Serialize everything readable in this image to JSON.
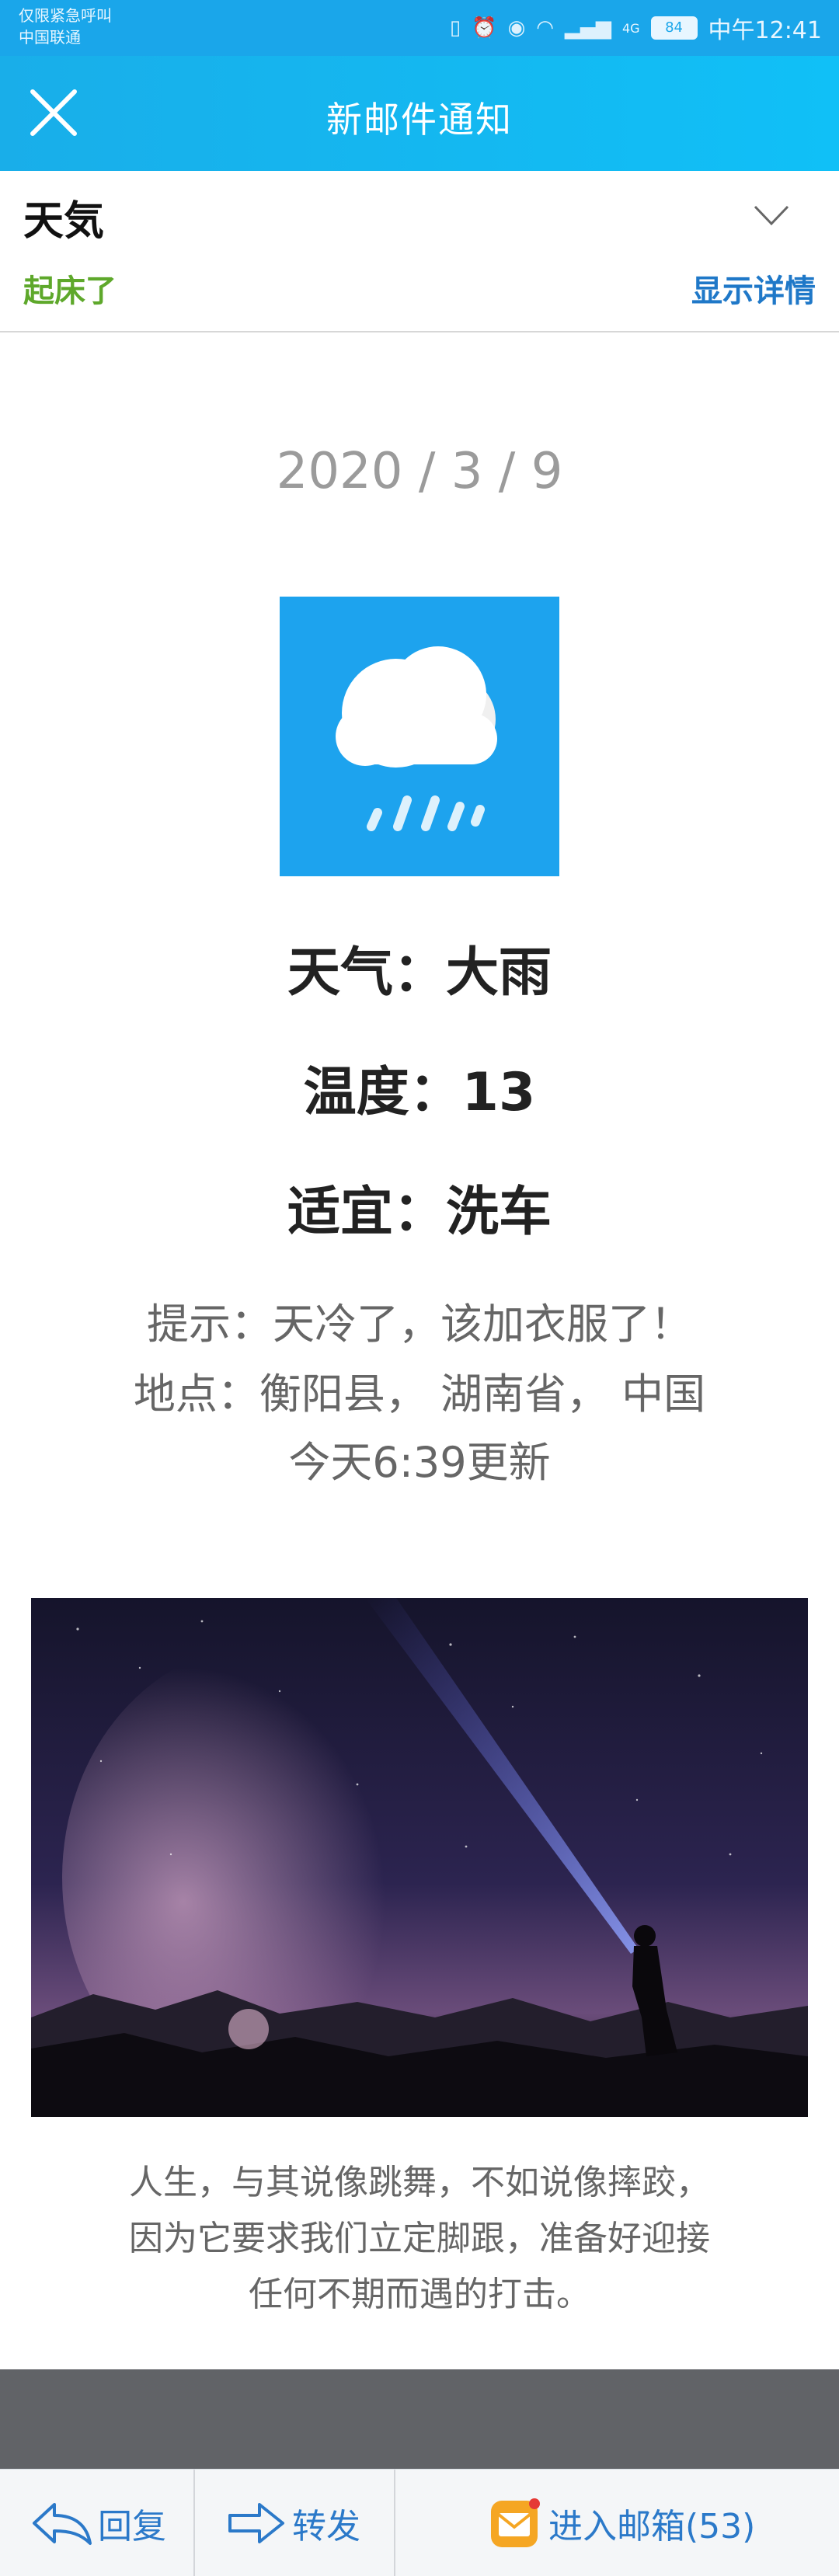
{
  "status_bar": {
    "carrier_top": "仅限紧急呼叫",
    "carrier_bottom": "中国联通",
    "battery": "84",
    "network": "4G",
    "time": "中午12:41"
  },
  "title_bar": {
    "title": "新邮件通知"
  },
  "mail_header": {
    "subject": "天気",
    "sender": "起床了",
    "show_details": "显示详情"
  },
  "content": {
    "date": "2020 / 3 / 9",
    "weather_line": "天气：大雨",
    "temperature_line": "温度：13",
    "suitable_line": "适宜：洗车",
    "tip_line": "提示：天冷了，该加衣服了！",
    "location_line": "地点：衡阳县， 湖南省， 中国",
    "updated_line": "今天6:39更新",
    "quote_lines": [
      "人生，与其说像跳舞，不如说像摔跤，",
      "因为它要求我们立定脚跟，准备好迎接",
      "任何不期而遇的打击。"
    ]
  },
  "bottom_bar": {
    "reply": "回复",
    "forward": "转发",
    "open_mailbox": "进入邮箱(53)"
  },
  "colors": {
    "status_bar": "#1aa6ea",
    "title_gradient_start": "#19aee9",
    "title_gradient_end": "#10c0f7",
    "sender_green": "#5ea82b",
    "link_blue": "#1f78c8",
    "weather_icon_bg": "#1da3ee"
  }
}
